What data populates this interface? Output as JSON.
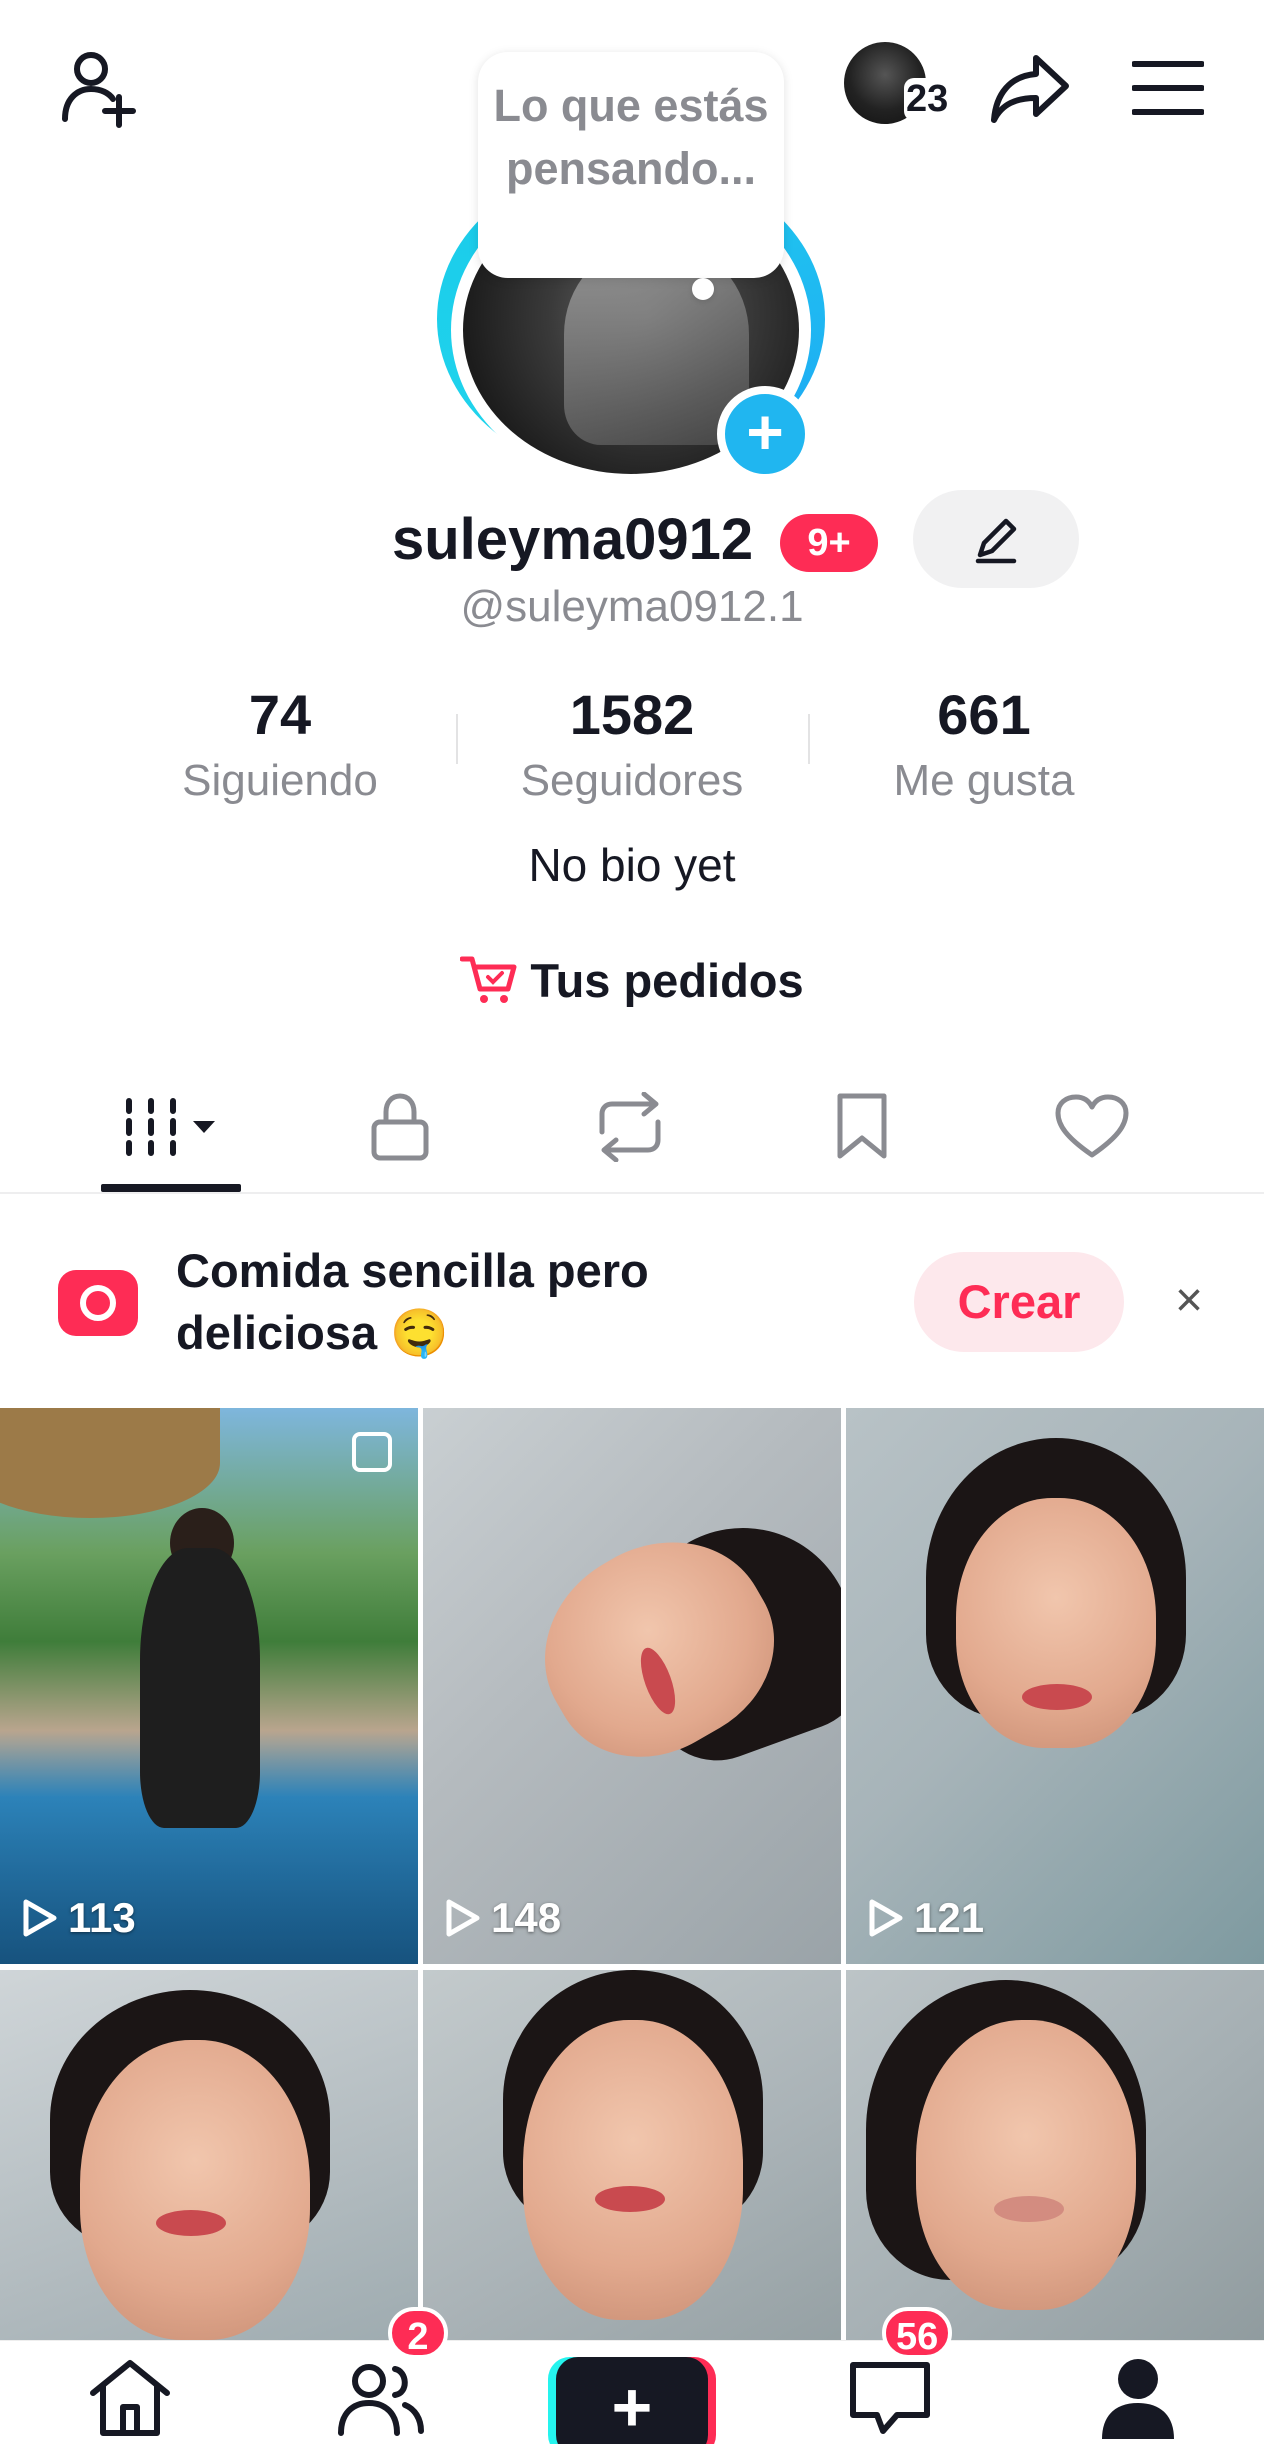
{
  "header": {
    "add_friend_icon": "person-plus-icon",
    "visitor_count": "23",
    "share_icon": "share-arrow-icon",
    "menu_icon": "hamburger-menu-icon"
  },
  "avatar": {
    "thought_prompt": "Lo que estás pensando...",
    "add_story_symbol": "+"
  },
  "profile": {
    "username": "suleyma0912",
    "notification_badge": "9+",
    "handle": "@suleyma0912.1",
    "bio": "No bio yet"
  },
  "stats": [
    {
      "value": "74",
      "label": "Siguiendo"
    },
    {
      "value": "1582",
      "label": "Seguidores"
    },
    {
      "value": "661",
      "label": "Me gusta"
    }
  ],
  "orders": {
    "label": "Tus pedidos"
  },
  "tabs": [
    "videos-grid",
    "private",
    "reposts",
    "favorites",
    "liked"
  ],
  "banner": {
    "text": "Comida sencilla pero deliciosa 🤤",
    "button": "Crear",
    "close": "×"
  },
  "videos": [
    {
      "views": "113"
    },
    {
      "views": "148"
    },
    {
      "views": "121"
    },
    {
      "views": ""
    },
    {
      "views": ""
    },
    {
      "views": ""
    }
  ],
  "bottom_nav": {
    "friends_badge": "2",
    "inbox_badge": "56",
    "create_symbol": "+"
  },
  "colors": {
    "accent": "#fe2c55",
    "ring": "#20d5ec",
    "text_secondary": "#8a8b91"
  }
}
